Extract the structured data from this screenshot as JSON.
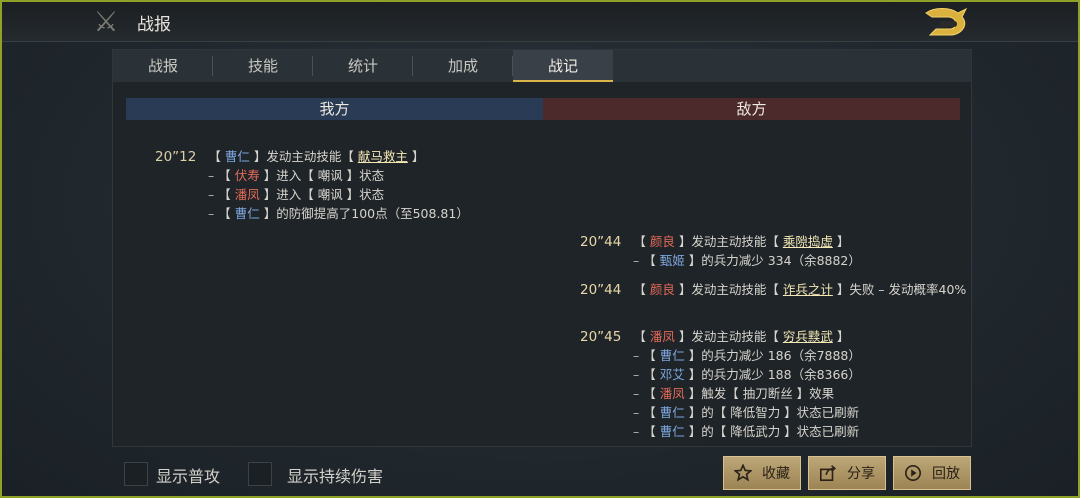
{
  "header": {
    "title": "战报"
  },
  "tabs": [
    {
      "label": "战报",
      "active": false
    },
    {
      "label": "技能",
      "active": false
    },
    {
      "label": "统计",
      "active": false
    },
    {
      "label": "加成",
      "active": false
    },
    {
      "label": "战记",
      "active": true
    }
  ],
  "sides": {
    "ally": "我方",
    "enemy": "敌方"
  },
  "log": {
    "ally": [
      {
        "time": "20”12",
        "actor": "曹仁",
        "text": "发动主动技能",
        "skill": "献马救主"
      },
      {
        "target": "伏寿",
        "text": "进入【 嘲讽 】状态"
      },
      {
        "target": "潘凤",
        "text": "进入【 嘲讽 】状态"
      },
      {
        "target": "曹仁",
        "text": "的防御提高了100点（至508.81）"
      }
    ],
    "enemy": [
      {
        "time": "20”44",
        "actor": "颜良",
        "text": "发动主动技能",
        "skill": "乘隙捣虚"
      },
      {
        "target": "甄姬",
        "text": "的兵力减少 334（余8882）"
      },
      {
        "time": "20”44",
        "actor": "颜良",
        "text": "发动主动技能",
        "skill": "诈兵之计",
        "suffix": "失败 – 发动概率40%"
      },
      {
        "time": "20”45",
        "actor": "潘凤",
        "text": "发动主动技能",
        "skill": "穷兵黩武"
      },
      {
        "target": "曹仁",
        "text": "的兵力减少 186（余7888）"
      },
      {
        "target": "邓艾",
        "text": "的兵力减少 188（余8366）"
      },
      {
        "target": "潘凤",
        "text": "触发【 抽刀断丝 】效果"
      },
      {
        "target": "曹仁",
        "text": "的【 降低智力 】状态已刷新"
      },
      {
        "target": "曹仁",
        "text": "的【 降低武力 】状态已刷新"
      }
    ]
  },
  "options": {
    "show_normal_attack": "显示普攻",
    "show_dot_damage": "显示持续伤害"
  },
  "buttons": {
    "favorite": "收藏",
    "share": "分享",
    "replay": "回放"
  },
  "colors": {
    "ally_name": "#7ea7de",
    "enemy_name": "#e36a58",
    "active_tab_accent": "#d9b44a",
    "button_gold": "#bda677",
    "border_green": "#8fa126"
  }
}
